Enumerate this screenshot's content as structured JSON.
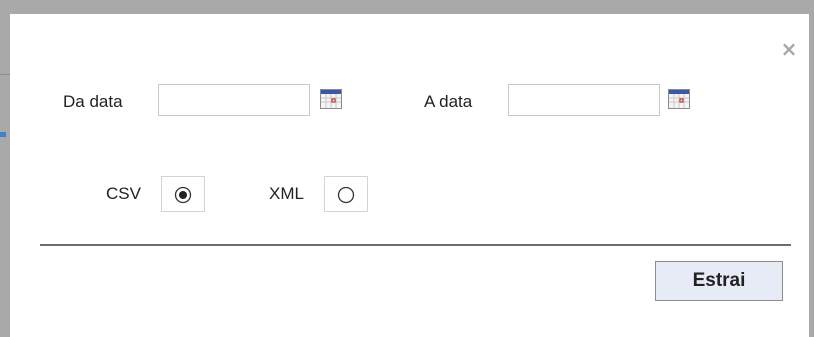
{
  "dialog": {
    "close_symbol": "×",
    "from_date": {
      "label": "Da data",
      "value": "",
      "icon": "calendar-icon"
    },
    "to_date": {
      "label": "A data",
      "value": "",
      "icon": "calendar-icon"
    },
    "format_options": [
      {
        "label": "CSV",
        "selected": true
      },
      {
        "label": "XML",
        "selected": false
      }
    ],
    "extract_label": "Estrai"
  },
  "colors": {
    "button_bg": "#e6ebf5",
    "backdrop": "#a9a9a9",
    "close_icon": "#a7a7a7",
    "calendar_header": "#3a57a8",
    "calendar_mark": "#c0392b"
  }
}
